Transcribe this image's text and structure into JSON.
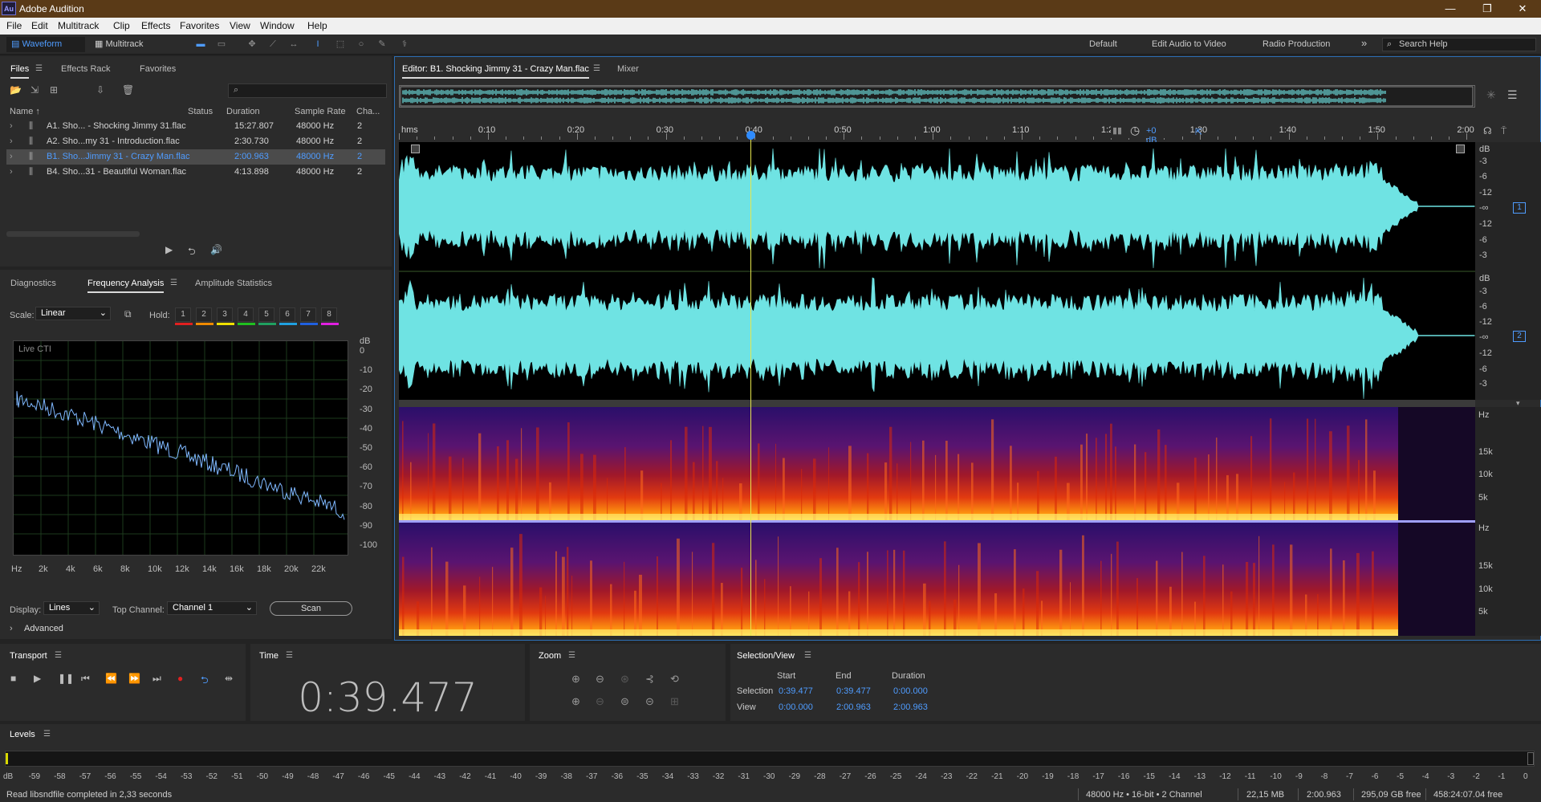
{
  "app": {
    "title": "Adobe Audition",
    "logo": "Au"
  },
  "window_controls": [
    "—",
    "❐",
    "✕"
  ],
  "menu": [
    "File",
    "Edit",
    "Multitrack",
    "Clip",
    "Effects",
    "Favorites",
    "View",
    "Window",
    "Help"
  ],
  "toolbar": {
    "waveform_label": "Waveform",
    "multitrack_label": "Multitrack",
    "workspaces": [
      "Default",
      "Edit Audio to Video",
      "Radio Production"
    ],
    "more": "»",
    "search_placeholder": "Search Help"
  },
  "files_panel": {
    "tabs": [
      "Files",
      "Effects Rack",
      "Favorites"
    ],
    "headers": {
      "name": "Name ↑",
      "status": "Status",
      "duration": "Duration",
      "sample_rate": "Sample Rate",
      "channels": "Cha..."
    },
    "search_icon": "⌕",
    "rows": [
      {
        "name": "A1. Sho... - Shocking Jimmy 31.flac",
        "duration": "15:27.807",
        "rate": "48000 Hz",
        "ch": "2"
      },
      {
        "name": "A2. Sho...my 31 - Introduction.flac",
        "duration": "2:30.730",
        "rate": "48000 Hz",
        "ch": "2"
      },
      {
        "name": "B1. Sho...Jimmy 31 - Crazy Man.flac",
        "duration": "2:00.963",
        "rate": "48000 Hz",
        "ch": "2"
      },
      {
        "name": "B4. Sho...31 - Beautiful Woman.flac",
        "duration": "4:13.898",
        "rate": "48000 Hz",
        "ch": "2"
      }
    ],
    "selected_index": 2
  },
  "analysis_panel": {
    "tabs": [
      "Diagnostics",
      "Frequency Analysis",
      "Amplitude Statistics"
    ],
    "scale_label": "Scale:",
    "scale_value": "Linear",
    "hold_label": "Hold:",
    "hold_buttons": [
      "1",
      "2",
      "3",
      "4",
      "5",
      "6",
      "7",
      "8"
    ],
    "hold_colors": [
      "#e02020",
      "#f08a00",
      "#f0e000",
      "#20c020",
      "#20a060",
      "#20a0e0",
      "#2060e0",
      "#e020e0"
    ],
    "graph_label": "Live CTI",
    "db_ticks": [
      "dB",
      "0",
      "-10",
      "-20",
      "-30",
      "-40",
      "-50",
      "-60",
      "-70",
      "-80",
      "-90",
      "-100"
    ],
    "hz_ticks": [
      "Hz",
      "2k",
      "4k",
      "6k",
      "8k",
      "10k",
      "12k",
      "14k",
      "16k",
      "18k",
      "20k",
      "22k"
    ],
    "display_label": "Display:",
    "display_value": "Lines",
    "top_channel_label": "Top Channel:",
    "top_channel_value": "Channel 1",
    "scan_label": "Scan",
    "advanced_label": "Advanced"
  },
  "editor": {
    "tab_label": "Editor: B1. Shocking Jimmy 31 - Crazy Man.flac",
    "mixer_label": "Mixer",
    "ruler": [
      "hms",
      "0:10",
      "0:20",
      "0:30",
      "0:40",
      "0:50",
      "1:00",
      "1:10",
      "1:20",
      "1:30",
      "1:40",
      "1:50",
      "2:00"
    ],
    "gain_label": "+0 dB",
    "db_scale_ch1": [
      "dB",
      "-3",
      "-6",
      "-12",
      "-∞",
      "-12",
      "-6",
      "-3"
    ],
    "db_scale_ch2": [
      "dB",
      "-3",
      "-6",
      "-12",
      "-∞",
      "-12",
      "-6",
      "-3"
    ],
    "channel_badges": [
      "1",
      "2"
    ],
    "hz_scale": [
      "Hz",
      "15k",
      "10k",
      "5k"
    ],
    "waveform_color": "#6fe3e3",
    "playhead_fraction": 0.3266
  },
  "transport": {
    "title": "Transport"
  },
  "time": {
    "title": "Time",
    "value": "0:39.477"
  },
  "zoom": {
    "title": "Zoom"
  },
  "selection_view": {
    "title": "Selection/View",
    "col_start": "Start",
    "col_end": "End",
    "col_duration": "Duration",
    "selection_label": "Selection",
    "view_label": "View",
    "selection": {
      "start": "0:39.477",
      "end": "0:39.477",
      "duration": "0:00.000"
    },
    "view": {
      "start": "0:00.000",
      "end": "2:00.963",
      "duration": "2:00.963"
    }
  },
  "levels": {
    "title": "Levels",
    "ticks": [
      "dB",
      "-59",
      "-58",
      "-57",
      "-56",
      "-55",
      "-54",
      "-53",
      "-52",
      "-51",
      "-50",
      "-49",
      "-48",
      "-47",
      "-46",
      "-45",
      "-44",
      "-43",
      "-42",
      "-41",
      "-40",
      "-39",
      "-38",
      "-37",
      "-36",
      "-35",
      "-34",
      "-33",
      "-32",
      "-31",
      "-30",
      "-29",
      "-28",
      "-27",
      "-26",
      "-25",
      "-24",
      "-23",
      "-22",
      "-21",
      "-20",
      "-19",
      "-18",
      "-17",
      "-16",
      "-15",
      "-14",
      "-13",
      "-12",
      "-11",
      "-10",
      "-9",
      "-8",
      "-7",
      "-6",
      "-5",
      "-4",
      "-3",
      "-2",
      "-1",
      "0"
    ]
  },
  "status_bar": {
    "message": "Read libsndfile completed in 2,33 seconds",
    "format": "48000 Hz • 16-bit • 2 Channel",
    "size": "22,15 MB",
    "duration": "2:00.963",
    "free": "295,09 GB free",
    "free_time": "458:24:07.04 free"
  }
}
